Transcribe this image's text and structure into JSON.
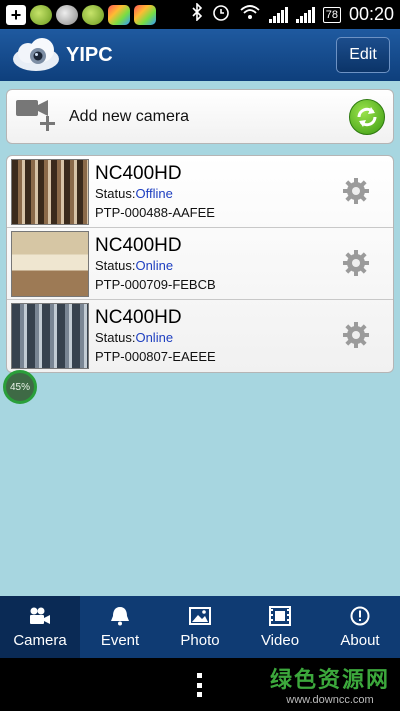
{
  "status_bar": {
    "battery": "78",
    "time": "00:20",
    "icons": [
      "add-icon",
      "status-app-icon",
      "eye-icon",
      "status-app-icon",
      "app-icon",
      "app-icon",
      "bluetooth-icon",
      "alarm-icon",
      "wifi-icon",
      "signal-icon",
      "signal-icon",
      "battery-icon"
    ]
  },
  "header": {
    "title": "YIPC",
    "edit_label": "Edit"
  },
  "add_camera": {
    "label": "Add new camera"
  },
  "cameras": [
    {
      "name": "NC400HD",
      "status_label": "Status:",
      "status": "Offline",
      "id": "PTP-000488-AAFEE"
    },
    {
      "name": "NC400HD",
      "status_label": "Status:",
      "status": "Online",
      "id": "PTP-000709-FEBCB"
    },
    {
      "name": "NC400HD",
      "status_label": "Status:",
      "status": "Online",
      "id": "PTP-000807-EAEEE"
    }
  ],
  "progress_badge": "45%",
  "tabs": [
    {
      "label": "Camera",
      "icon": "camera-icon",
      "active": true
    },
    {
      "label": "Event",
      "icon": "bell-icon",
      "active": false
    },
    {
      "label": "Photo",
      "icon": "photo-icon",
      "active": false
    },
    {
      "label": "Video",
      "icon": "film-icon",
      "active": false
    },
    {
      "label": "About",
      "icon": "info-icon",
      "active": false
    }
  ],
  "watermark": {
    "title": "绿色资源网",
    "url": "www.downcc.com"
  },
  "colors": {
    "header": "#1f5aa0",
    "content_bg": "#a7d6e0",
    "tabbar": "#0f3b73",
    "status_link": "#1e3fc0"
  }
}
